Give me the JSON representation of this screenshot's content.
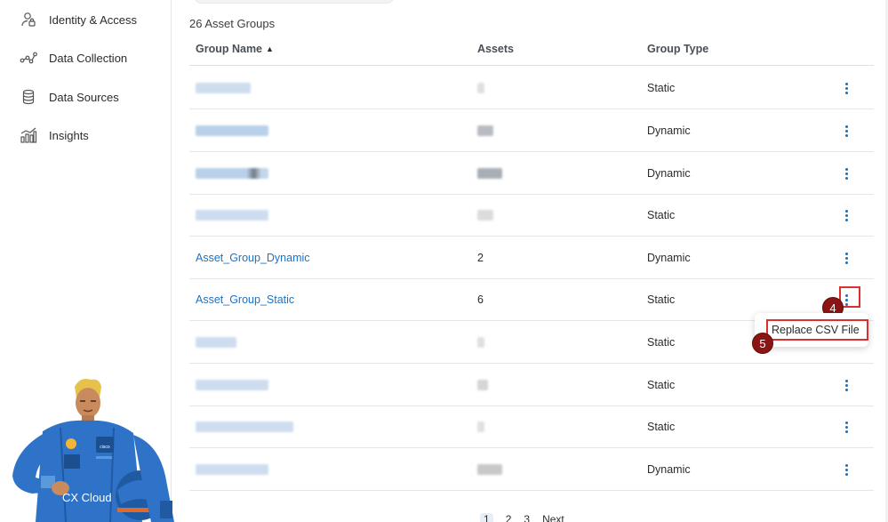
{
  "sidebar": {
    "items": [
      {
        "label": "Identity & Access",
        "icon": "user-lock-icon"
      },
      {
        "label": "Data Collection",
        "icon": "data-collection-icon"
      },
      {
        "label": "Data Sources",
        "icon": "database-icon"
      },
      {
        "label": "Insights",
        "icon": "insights-chart-icon"
      }
    ],
    "mascot_label": "CX Cloud"
  },
  "table": {
    "count_label": "26 Asset Groups",
    "headers": {
      "name": "Group Name",
      "assets": "Assets",
      "type": "Group Type"
    },
    "sort": "ascending",
    "rows": [
      {
        "name": "",
        "assets": "",
        "type": "Static"
      },
      {
        "name": "",
        "assets": "",
        "type": "Dynamic"
      },
      {
        "name": "",
        "assets": "",
        "type": "Dynamic"
      },
      {
        "name": "",
        "assets": "",
        "type": "Static"
      },
      {
        "name": "Asset_Group_Dynamic",
        "assets": "2",
        "type": "Dynamic"
      },
      {
        "name": "Asset_Group_Static",
        "assets": "6",
        "type": "Static"
      },
      {
        "name": "",
        "assets": "",
        "type": "Static"
      },
      {
        "name": "",
        "assets": "",
        "type": "Static"
      },
      {
        "name": "",
        "assets": "",
        "type": "Static"
      },
      {
        "name": "",
        "assets": "",
        "type": "Dynamic"
      }
    ]
  },
  "row_menu": {
    "item": "Replace CSV File"
  },
  "annotations": {
    "step_a": "4",
    "step_b": "5"
  },
  "pagination": {
    "pages": [
      "1",
      "2",
      "3"
    ],
    "next": "Next"
  },
  "colors": {
    "link": "#1a73c8",
    "accent": "#1a6fc4",
    "annotation": "#d93030",
    "badge": "#8b1515"
  }
}
